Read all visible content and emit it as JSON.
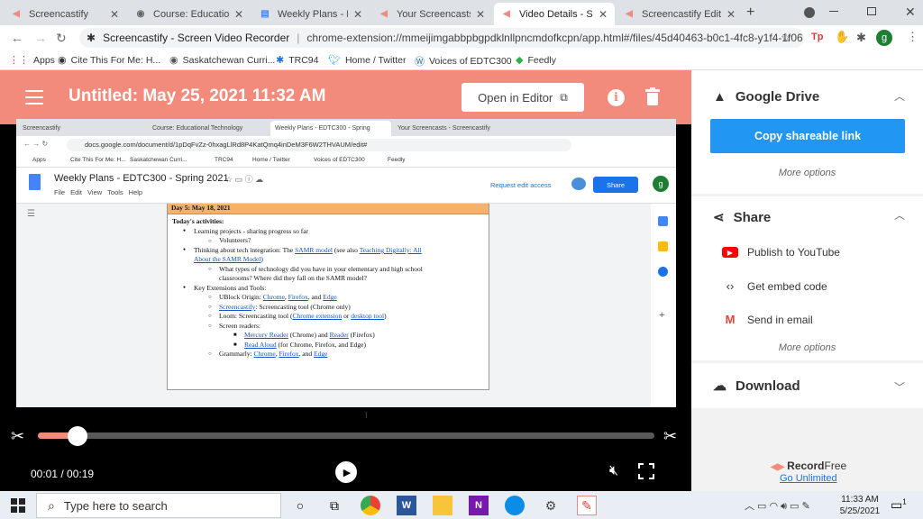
{
  "browser": {
    "tabs": [
      {
        "label": "Screencastify",
        "active": false,
        "icon": "screencastify-icon"
      },
      {
        "label": "Course: Educational",
        "active": false,
        "icon": "globe-icon"
      },
      {
        "label": "Weekly Plans - EDT",
        "active": false,
        "icon": "docs-icon"
      },
      {
        "label": "Your Screencasts - S",
        "active": false,
        "icon": "screencastify-icon"
      },
      {
        "label": "Video Details - Scre",
        "active": true,
        "icon": "screencastify-icon"
      },
      {
        "label": "Screencastify Edit",
        "active": false,
        "icon": "screencastify-icon"
      }
    ],
    "new_tab": "+",
    "omnibox": {
      "site_label": "Screencastify - Screen Video Recorder",
      "url": "chrome-extension://mmeijimgabbpbgpdklnllpncmdofkcpn/app.html#/files/45d40463-b0c1-4fc8-y1f4-1f06..."
    },
    "profile_initial": "g",
    "bookmarks": [
      {
        "label": "Apps",
        "icon": "apps-icon"
      },
      {
        "label": "Cite This For Me: H...",
        "icon": "cite-icon"
      },
      {
        "label": "Saskatchewan Curri...",
        "icon": "globe-icon"
      },
      {
        "label": "TRC94",
        "icon": "trc-icon"
      },
      {
        "label": "Home / Twitter",
        "icon": "twitter-icon"
      },
      {
        "label": "Voices of EDTC300",
        "icon": "wordpress-icon"
      },
      {
        "label": "Feedly",
        "icon": "feedly-icon"
      }
    ]
  },
  "app": {
    "title": "Untitled: May 25, 2021 11:32 AM",
    "open_editor_label": "Open in Editor",
    "accent": "#f38b7d"
  },
  "recording": {
    "tabs": [
      "Screencastify",
      "Course: Educational Technology",
      "Weekly Plans - EDTC300 - Spring",
      "Your Screencasts - Screencastify"
    ],
    "url": "docs.google.com/document/d/1pDqFvZz-0hxagLlRd8P4KatQmq4inDeM3F6W2THVAUM/edit#",
    "bookmarks": [
      "Apps",
      "Cite This For Me: H...",
      "Saskatchewan Curri...",
      "TRC94",
      "Home / Twitter",
      "Voices of EDTC300",
      "Feedly"
    ],
    "doc_title": "Weekly Plans - EDTC300 - Spring 2021",
    "doc_menu": [
      "File",
      "Edit",
      "View",
      "Tools",
      "Help"
    ],
    "request_edit": "Request edit access",
    "share_label": "Share",
    "avatar_initial": "g",
    "day_header": "Day 5: May 18, 2021",
    "activities_heading": "Today's activities:",
    "items": [
      {
        "level": 1,
        "parts": [
          {
            "t": "Learning projects - sharing progress so far"
          }
        ]
      },
      {
        "level": 2,
        "parts": [
          {
            "t": "Volunteers?"
          }
        ]
      },
      {
        "level": 1,
        "parts": [
          {
            "t": "Thinking about tech integration: The "
          },
          {
            "t": "SAMR model",
            "link": true
          },
          {
            "t": " (see also "
          },
          {
            "t": "Teaching Digitally: All",
            "link": true
          }
        ]
      },
      {
        "level": 1,
        "parts": [
          {
            "t": "About the SAMR Model",
            "link": true
          },
          {
            "t": ")"
          }
        ]
      },
      {
        "level": 2,
        "parts": [
          {
            "t": "What types of technology did you have in your elementary and high school"
          }
        ]
      },
      {
        "level": 2,
        "parts": [
          {
            "t": "classrooms? Where did they fall on the SAMR model?"
          }
        ]
      },
      {
        "level": 1,
        "parts": [
          {
            "t": "Key Extensions and Tools:"
          }
        ]
      },
      {
        "level": 2,
        "parts": [
          {
            "t": "UBlock Origin: "
          },
          {
            "t": "Chrome",
            "link": true
          },
          {
            "t": ", "
          },
          {
            "t": "Firefox",
            "link": true
          },
          {
            "t": ", and "
          },
          {
            "t": "Edge",
            "link": true
          }
        ]
      },
      {
        "level": 2,
        "parts": [
          {
            "t": "Screencastify",
            "link": true
          },
          {
            "t": ": Screencasting tool (Chrome only)"
          }
        ]
      },
      {
        "level": 2,
        "parts": [
          {
            "t": "Loom: Screencasting tool ("
          },
          {
            "t": "Chrome extension",
            "link": true
          },
          {
            "t": " or "
          },
          {
            "t": "desktop tool",
            "link": true
          },
          {
            "t": ")"
          }
        ]
      },
      {
        "level": 2,
        "parts": [
          {
            "t": "Screen readers:"
          }
        ]
      },
      {
        "level": 3,
        "parts": [
          {
            "t": "Mercury Reader",
            "link": true
          },
          {
            "t": " (Chrome) and "
          },
          {
            "t": "Reader",
            "link": true
          },
          {
            "t": " (Firefox)"
          }
        ]
      },
      {
        "level": 3,
        "parts": [
          {
            "t": "Read Aloud",
            "link": true
          },
          {
            "t": " (for Chrome, Firefox, and Edge)"
          }
        ]
      },
      {
        "level": 2,
        "parts": [
          {
            "t": "Grammarly: "
          },
          {
            "t": "Chrome",
            "link": true
          },
          {
            "t": ", "
          },
          {
            "t": "Firefox",
            "link": true
          },
          {
            "t": ", and "
          },
          {
            "t": "Edge",
            "link": true
          }
        ]
      }
    ]
  },
  "player": {
    "time_current": "00:01",
    "time_total": "00:19",
    "time_display": "00:01 / 00:19",
    "progress_fraction": 0.053
  },
  "panel": {
    "drive": {
      "title": "Google Drive",
      "copy_label": "Copy shareable link",
      "more": "More options"
    },
    "share": {
      "title": "Share",
      "items": [
        {
          "label": "Publish to YouTube",
          "icon": "youtube-icon"
        },
        {
          "label": "Get embed code",
          "icon": "code-icon"
        },
        {
          "label": "Send in email",
          "icon": "gmail-icon"
        }
      ],
      "more": "More options"
    },
    "download": {
      "title": "Download"
    },
    "promo": {
      "brand_record": "Record",
      "brand_free": "Free",
      "link": "Go Unlimited"
    }
  },
  "taskbar": {
    "search_placeholder": "Type here to search",
    "time": "11:33 AM",
    "date": "5/25/2021",
    "notification_count": "1"
  }
}
